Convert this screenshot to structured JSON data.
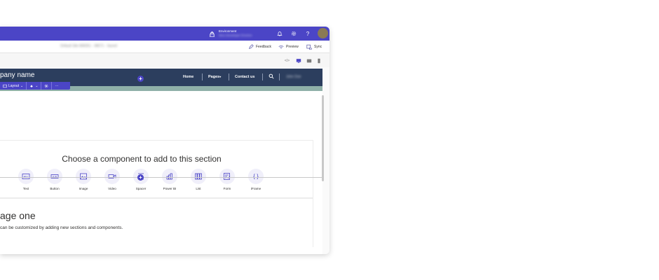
{
  "topbar": {
    "environment_label": "Environment",
    "environment_value": "Woo Developer Envrion",
    "icons": [
      "bell-icon",
      "gear-icon",
      "help-icon",
      "avatar"
    ]
  },
  "cmdbar": {
    "site_title": "Default Site 808351 - 08071 - Saved",
    "feedback_label": "Feedback",
    "preview_label": "Preview",
    "sync_label": "Sync"
  },
  "devbar": {
    "icons": [
      "code-icon",
      "desktop-icon",
      "tablet-icon",
      "mobile-icon"
    ],
    "selected": "desktop"
  },
  "site_header": {
    "company_name": "pany name",
    "nav": [
      "Home",
      "Pages",
      "Contact us"
    ],
    "user_name": "John Doe"
  },
  "section_toolbar": {
    "layout_label": "Layout",
    "more_label": "···"
  },
  "picker": {
    "title": "Choose a component to add to this section",
    "components": [
      {
        "label": "Text",
        "icon": "text-icon"
      },
      {
        "label": "Button",
        "icon": "button-icon"
      },
      {
        "label": "Image",
        "icon": "image-icon"
      },
      {
        "label": "Video",
        "icon": "video-icon"
      },
      {
        "label": "Spacer",
        "icon": "spacer-icon"
      },
      {
        "label": "Power BI",
        "icon": "powerbi-icon"
      },
      {
        "label": "List",
        "icon": "list-icon"
      },
      {
        "label": "Form",
        "icon": "form-icon"
      },
      {
        "label": "iFrame",
        "icon": "iframe-icon"
      }
    ]
  },
  "content": {
    "heading": "age one",
    "description": "can be customized by adding new sections and components."
  },
  "colors": {
    "accent": "#4b45c6",
    "site_header": "#2c3e5e",
    "strip": "#8fb0a8"
  }
}
